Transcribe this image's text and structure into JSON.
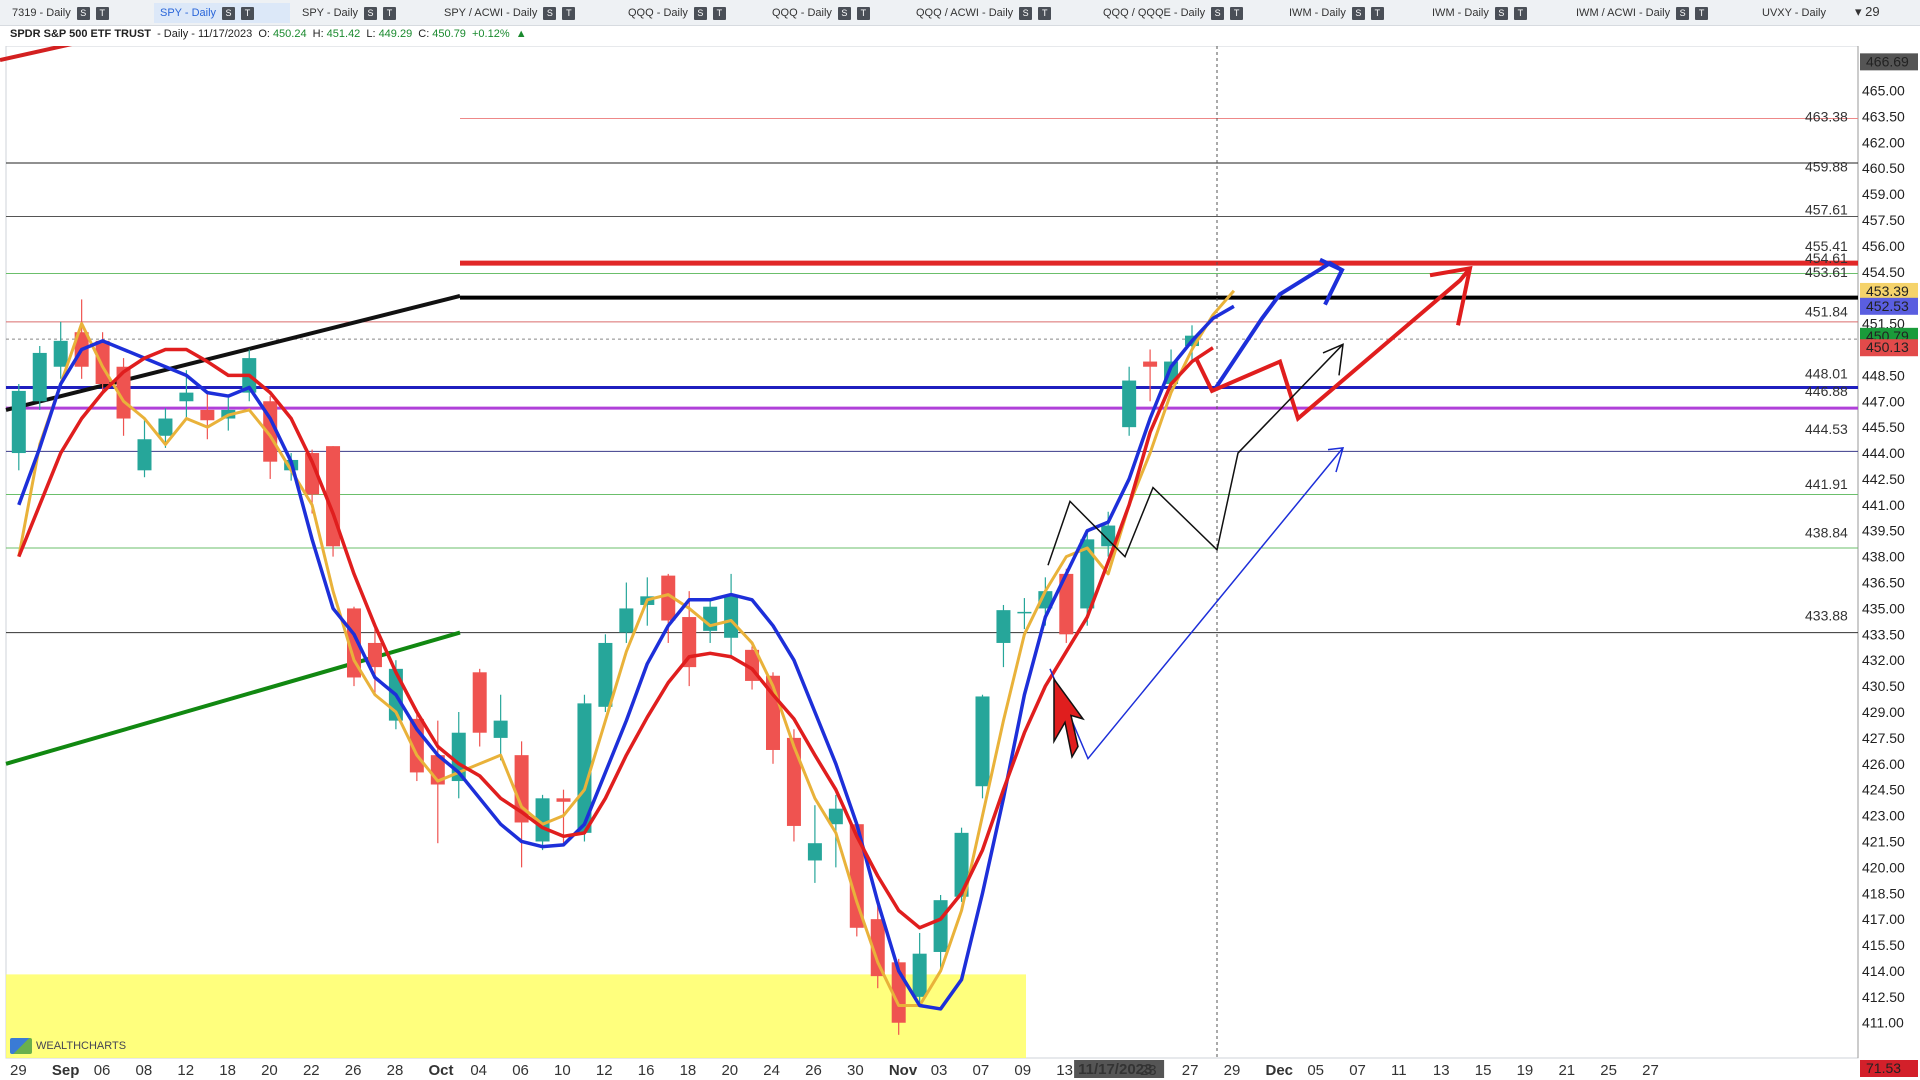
{
  "tabs": [
    {
      "label": "7319 - Daily",
      "x": 6,
      "w": 118,
      "active": false
    },
    {
      "label": "SPY - Daily",
      "x": 154,
      "w": 136,
      "active": true
    },
    {
      "label": "SPY - Daily",
      "x": 296,
      "w": 132,
      "active": false
    },
    {
      "label": "SPY / ACWI - Daily",
      "x": 438,
      "w": 150,
      "active": false
    },
    {
      "label": "QQQ - Daily",
      "x": 622,
      "w": 132,
      "active": false
    },
    {
      "label": "QQQ - Daily",
      "x": 766,
      "w": 132,
      "active": false
    },
    {
      "label": "QQQ / ACWI - Daily",
      "x": 910,
      "w": 150,
      "active": false
    },
    {
      "label": "QQQ / QQQE - Daily",
      "x": 1097,
      "w": 160,
      "active": false
    },
    {
      "label": "IWM - Daily",
      "x": 1283,
      "w": 130,
      "active": false
    },
    {
      "label": "IWM - Daily",
      "x": 1426,
      "w": 130,
      "active": false
    },
    {
      "label": "IWM / ACWI - Daily",
      "x": 1570,
      "w": 150,
      "active": false
    },
    {
      "label": "UVXY - Daily",
      "x": 1756,
      "w": 90,
      "active": false
    }
  ],
  "tab_more": "▾ 29",
  "info": {
    "symbol": "SPDR S&P 500 ETF TRUST",
    "period": "- Daily - 11/17/2023",
    "o_label": "O:",
    "o": "450.24",
    "h_label": "H:",
    "h": "451.42",
    "l_label": "L:",
    "l": "449.29",
    "c_label": "C:",
    "c": "450.79",
    "chg": "+0.12%"
  },
  "watermark": "WEALTHCHARTS",
  "chart_data": {
    "type": "candlestick",
    "title": "SPDR S&P 500 ETF TRUST - Daily - 11/17/2023",
    "ylim": [
      410.0,
      467.0
    ],
    "price_ticks": [
      "465.00",
      "463.50",
      "462.00",
      "460.50",
      "459.00",
      "457.50",
      "456.00",
      "454.50",
      "453.00",
      "451.50",
      "450.00",
      "448.50",
      "447.00",
      "445.50",
      "444.00",
      "442.50",
      "441.00",
      "439.50",
      "438.00",
      "436.50",
      "435.00",
      "433.50",
      "432.00",
      "430.50",
      "429.00",
      "427.50",
      "426.00",
      "424.50",
      "423.00",
      "421.50",
      "420.00",
      "418.50",
      "417.00",
      "415.50",
      "414.00",
      "412.50",
      "411.00"
    ],
    "date_labels": [
      "29",
      "Sep",
      "06",
      "08",
      "12",
      "18",
      "20",
      "22",
      "26",
      "28",
      "Oct",
      "04",
      "06",
      "10",
      "12",
      "16",
      "18",
      "20",
      "24",
      "26",
      "30",
      "Nov",
      "03",
      "07",
      "09",
      "13",
      "11/17/2023",
      "23",
      "27",
      "29",
      "Dec",
      "05",
      "07",
      "11",
      "13",
      "15",
      "19",
      "21",
      "25",
      "27"
    ],
    "level_labels": [
      "463.38",
      "459.88",
      "457.61",
      "455.41",
      "454.61",
      "453.61",
      "451.84",
      "448.01",
      "446.88",
      "444.53",
      "441.91",
      "438.84",
      "433.88"
    ],
    "badges": [
      {
        "text": "466.69",
        "color": "#555555"
      },
      {
        "text": "453.39",
        "color": "#f5d36b"
      },
      {
        "text": "452.53",
        "color": "#5a5ee0"
      },
      {
        "text": "450.79",
        "color": "#1a9b3a"
      },
      {
        "text": "450.13",
        "color": "#e24a4a"
      },
      {
        "text": "71.53",
        "color": "#d3202a"
      }
    ],
    "candles": [
      {
        "o": 444.0,
        "h": 448.0,
        "l": 443.0,
        "c": 447.6
      },
      {
        "o": 447.0,
        "h": 450.2,
        "l": 446.5,
        "c": 449.8
      },
      {
        "o": 449.0,
        "h": 451.6,
        "l": 448.3,
        "c": 450.5
      },
      {
        "o": 451.0,
        "h": 452.9,
        "l": 448.3,
        "c": 449.0
      },
      {
        "o": 450.5,
        "h": 451.0,
        "l": 447.5,
        "c": 448.0
      },
      {
        "o": 449.0,
        "h": 449.5,
        "l": 445.0,
        "c": 446.0
      },
      {
        "o": 443.0,
        "h": 446.0,
        "l": 442.6,
        "c": 444.8
      },
      {
        "o": 445.0,
        "h": 446.6,
        "l": 444.3,
        "c": 446.0
      },
      {
        "o": 447.0,
        "h": 448.8,
        "l": 446.0,
        "c": 447.5
      },
      {
        "o": 446.5,
        "h": 447.5,
        "l": 444.8,
        "c": 445.9
      },
      {
        "o": 446.0,
        "h": 447.2,
        "l": 445.3,
        "c": 446.5
      },
      {
        "o": 447.5,
        "h": 450.0,
        "l": 447.0,
        "c": 449.5
      },
      {
        "o": 447.0,
        "h": 447.3,
        "l": 442.5,
        "c": 443.5
      },
      {
        "o": 443.0,
        "h": 444.0,
        "l": 442.4,
        "c": 443.6
      },
      {
        "o": 444.0,
        "h": 444.2,
        "l": 440.5,
        "c": 441.6
      },
      {
        "o": 444.4,
        "h": 444.4,
        "l": 438.0,
        "c": 438.6
      },
      {
        "o": 435.0,
        "h": 435.1,
        "l": 430.5,
        "c": 431.0
      },
      {
        "o": 433.0,
        "h": 434.0,
        "l": 430.0,
        "c": 431.6
      },
      {
        "o": 428.5,
        "h": 432.0,
        "l": 428.0,
        "c": 431.5
      },
      {
        "o": 428.6,
        "h": 429.0,
        "l": 425.0,
        "c": 425.5
      },
      {
        "o": 426.5,
        "h": 428.5,
        "l": 421.4,
        "c": 424.8
      },
      {
        "o": 425.0,
        "h": 429.0,
        "l": 424.0,
        "c": 427.8
      },
      {
        "o": 431.3,
        "h": 431.5,
        "l": 427.0,
        "c": 427.8
      },
      {
        "o": 427.5,
        "h": 430.0,
        "l": 426.2,
        "c": 428.5
      },
      {
        "o": 426.5,
        "h": 427.3,
        "l": 420.0,
        "c": 422.6
      },
      {
        "o": 421.5,
        "h": 424.2,
        "l": 421.0,
        "c": 424.0
      },
      {
        "o": 424.0,
        "h": 424.5,
        "l": 421.3,
        "c": 423.8
      },
      {
        "o": 422.0,
        "h": 430.0,
        "l": 421.5,
        "c": 429.5
      },
      {
        "o": 429.3,
        "h": 433.5,
        "l": 429.0,
        "c": 433.0
      },
      {
        "o": 433.6,
        "h": 436.5,
        "l": 433.0,
        "c": 435.0
      },
      {
        "o": 435.2,
        "h": 436.8,
        "l": 434.0,
        "c": 435.7
      },
      {
        "o": 436.9,
        "h": 437.0,
        "l": 433.0,
        "c": 434.3
      },
      {
        "o": 434.5,
        "h": 436.0,
        "l": 430.5,
        "c": 431.6
      },
      {
        "o": 433.7,
        "h": 435.6,
        "l": 433.0,
        "c": 435.1
      },
      {
        "o": 433.3,
        "h": 437.0,
        "l": 432.3,
        "c": 435.8
      },
      {
        "o": 432.6,
        "h": 432.8,
        "l": 430.3,
        "c": 430.8
      },
      {
        "o": 431.1,
        "h": 431.3,
        "l": 426.0,
        "c": 426.8
      },
      {
        "o": 427.5,
        "h": 428.0,
        "l": 421.5,
        "c": 422.4
      },
      {
        "o": 420.4,
        "h": 423.6,
        "l": 419.1,
        "c": 421.4
      },
      {
        "o": 422.5,
        "h": 424.2,
        "l": 420.0,
        "c": 423.4
      },
      {
        "o": 422.5,
        "h": 422.5,
        "l": 416.0,
        "c": 416.5
      },
      {
        "o": 417.0,
        "h": 417.8,
        "l": 413.0,
        "c": 413.7
      },
      {
        "o": 414.5,
        "h": 414.7,
        "l": 410.3,
        "c": 411.0
      },
      {
        "o": 412.5,
        "h": 416.2,
        "l": 412.0,
        "c": 415.0
      },
      {
        "o": 415.1,
        "h": 418.4,
        "l": 414.0,
        "c": 418.1
      },
      {
        "o": 418.3,
        "h": 422.3,
        "l": 418.0,
        "c": 422.0
      },
      {
        "o": 424.7,
        "h": 430.0,
        "l": 424.0,
        "c": 429.9
      },
      {
        "o": 433.0,
        "h": 435.2,
        "l": 431.6,
        "c": 434.9
      },
      {
        "o": 434.8,
        "h": 435.6,
        "l": 433.8,
        "c": 434.8
      },
      {
        "o": 435.0,
        "h": 436.8,
        "l": 434.0,
        "c": 436.0
      },
      {
        "o": 437.0,
        "h": 437.3,
        "l": 433.0,
        "c": 433.5
      },
      {
        "o": 435.0,
        "h": 439.5,
        "l": 434.0,
        "c": 439.0
      },
      {
        "o": 438.6,
        "h": 440.6,
        "l": 438.0,
        "c": 439.8
      },
      {
        "o": 445.5,
        "h": 449.0,
        "l": 445.0,
        "c": 448.2
      },
      {
        "o": 449.3,
        "h": 450.0,
        "l": 447.0,
        "c": 449.0
      },
      {
        "o": 448.0,
        "h": 450.0,
        "l": 447.6,
        "c": 449.3
      },
      {
        "o": 450.2,
        "h": 451.4,
        "l": 449.3,
        "c": 450.8
      }
    ],
    "ma_gold": [
      438,
      444.5,
      448,
      451.5,
      449,
      447,
      446,
      444.5,
      446,
      445.5,
      446.2,
      446.5,
      445,
      443,
      441,
      436,
      432,
      430,
      429,
      426.5,
      425,
      425.5,
      426,
      426.5,
      423.5,
      422.5,
      423,
      424.5,
      428.5,
      432.5,
      435.5,
      435.8,
      435,
      434,
      434.3,
      433,
      430.5,
      427,
      424,
      422,
      418,
      414.5,
      412,
      412,
      414,
      417.5,
      423,
      428.5,
      433.5,
      436,
      438,
      438.5,
      437,
      441,
      444,
      447.5,
      450,
      452,
      453.4
    ],
    "ma_blue": [
      441,
      444.3,
      448,
      450,
      450.5,
      450,
      449.5,
      449,
      448.5,
      447.5,
      447.3,
      447.8,
      446,
      443.5,
      439,
      435,
      433.5,
      431,
      430,
      428,
      426.5,
      425.5,
      424,
      422.5,
      421.5,
      421.2,
      421.3,
      422.5,
      425.5,
      428.5,
      431.8,
      434,
      435.5,
      435.5,
      435.8,
      435.5,
      434,
      432,
      429,
      426,
      422.5,
      418,
      414,
      412,
      411.8,
      413.5,
      418.5,
      424,
      430,
      434.5,
      437,
      439.5,
      440,
      442.5,
      446,
      449,
      450.5,
      451.8,
      452.5
    ],
    "ma_red": [
      438,
      441,
      444,
      446,
      447.5,
      448.7,
      449.5,
      450,
      450,
      449.3,
      448.5,
      448.5,
      447.5,
      446,
      443.5,
      440.5,
      437,
      434,
      431.3,
      429,
      427,
      426,
      425.3,
      424,
      423.2,
      422.3,
      421.8,
      422,
      424,
      426.5,
      428.7,
      430.7,
      432.2,
      432.4,
      432.2,
      431.5,
      430,
      428.6,
      426.5,
      424.5,
      421.8,
      419.5,
      417.5,
      416.5,
      417,
      418.5,
      421,
      424.5,
      427.8,
      430.5,
      432.5,
      434.5,
      437.7,
      441,
      445.2,
      448,
      449.3,
      450.1
    ],
    "dashed_at": "11/17/2023"
  }
}
